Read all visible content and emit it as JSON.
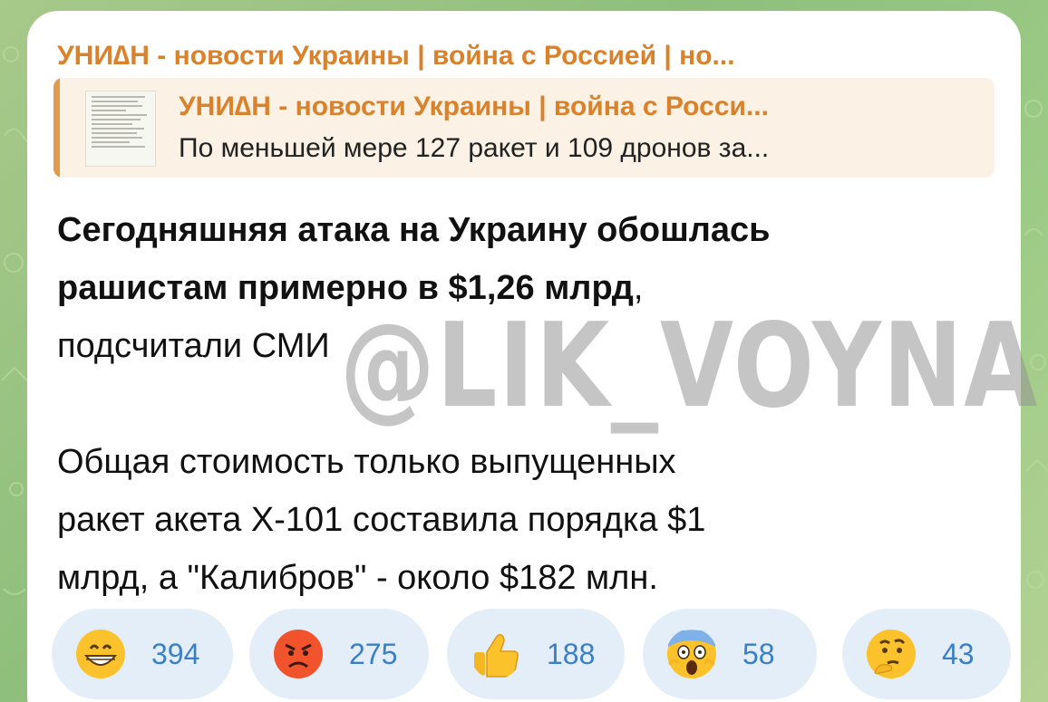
{
  "message": {
    "channel_name": "УНИ∆Н - новости Украины | война с Россией | но...",
    "reply": {
      "title": "УНИ∆Н - новости Украины | война с Росси...",
      "text": "По меньшей мере 127 ракет и 109 дронов за..."
    },
    "body": {
      "headline_line1": "Сегодняшняя атака на Украину обошлась",
      "headline_line2": "рашистам примерно в $1,26 млрд",
      "headline_suffix": ",",
      "line3": "подсчитали СМИ",
      "para2_line1": "Общая стоимость только выпущенных",
      "para2_line2": "ракет акета Х-101 составила порядка $1",
      "para2_line3": "млрд, а \"Калибров\" - около $182 млн."
    },
    "watermark": "@LIK_VOYNA"
  },
  "reactions": [
    {
      "emoji": "grinning-face",
      "count": "394"
    },
    {
      "emoji": "angry-face",
      "count": "275"
    },
    {
      "emoji": "thumbs-up",
      "count": "188"
    },
    {
      "emoji": "screaming-face",
      "count": "58"
    },
    {
      "emoji": "thinking-face",
      "count": "43"
    }
  ],
  "colors": {
    "channel_accent": "#d9822b",
    "reaction_bg": "#e4eef8",
    "reaction_text": "#3b7fc4"
  }
}
